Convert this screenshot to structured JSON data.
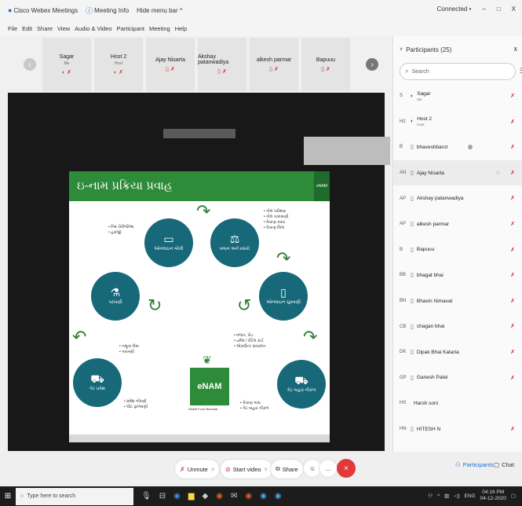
{
  "titlebar": {
    "app_name": "Cisco Webex Meetings",
    "meeting_info": "Meeting Info",
    "hide_menu": "Hide menu bar ^",
    "connected": "Connected •",
    "minimize": "–",
    "restore": "□",
    "close": "X"
  },
  "menubar": [
    "File",
    "Edit",
    "Share",
    "View",
    "Audio & Video",
    "Participant",
    "Meeting",
    "Help"
  ],
  "thumbnails": [
    {
      "name": "Sagar",
      "sub": "Me"
    },
    {
      "name": "Host 2",
      "sub": "Host"
    },
    {
      "name": "Ajay Nisarta",
      "sub": ""
    },
    {
      "name": "Akshay patanwadiya",
      "sub": ""
    },
    {
      "name": "alkesh parmar",
      "sub": ""
    },
    {
      "name": "Bapuuu",
      "sub": ""
    }
  ],
  "slide": {
    "title": "ઇ-નામ પ્રક્રિયા પ્રવાહ",
    "logo": "eNAM",
    "enam_text": "eNAM",
    "enam_tagline": "eNAM Food Bhandar",
    "stages": [
      {
        "label": "ઓનલાઇન બોલી"
      },
      {
        "label": "વજન અને વધારો"
      },
      {
        "label": "ઓનલાઇન ચુકવણી"
      },
      {
        "label": "ગેટ બહાર નીકળ"
      },
      {
        "label": "ગેટ પ્રવેશ"
      },
      {
        "label": "પરખણી"
      }
    ],
    "bullets": [
      "• નિદ ચેરીજોઆ\n• હરાજી",
      "• તોલ પરીક્ષણ\n• તોલ ચકાસણી\n• વેચાણ કરાર\n• વેચાણ બિલ",
      "• નમૂના લેવા\n• પરખણી",
      "• વજન, ખેડ\n• ઇમેલ / રીટેલ કાર્ડ\n• એકાઉન્ટ સંચાલન",
      "• પ્રવેશ નોંધણી\n• લોટ ફાળવણી",
      "• વેચાણ પાસ\n• ગેટ બહાર નીકળ"
    ]
  },
  "participants_panel": {
    "title": "Participants (25)",
    "close": "x",
    "search_placeholder": "Search",
    "list": [
      {
        "avatar": "S",
        "name": "Sagar",
        "sub": "Me"
      },
      {
        "avatar": "H2",
        "name": "Host 2",
        "sub": "Host"
      },
      {
        "avatar": "B",
        "name": "bhaveshbarot",
        "sub": ""
      },
      {
        "avatar": "AN",
        "name": "Ajay Nisarta",
        "sub": ""
      },
      {
        "avatar": "AP",
        "name": "Akshay patanwadiya",
        "sub": ""
      },
      {
        "avatar": "AP",
        "name": "alkesh parmar",
        "sub": ""
      },
      {
        "avatar": "B",
        "name": "Bapuuu",
        "sub": ""
      },
      {
        "avatar": "BB",
        "name": "bhagat bhai",
        "sub": ""
      },
      {
        "avatar": "BN",
        "name": "Bhavin Nimavat",
        "sub": ""
      },
      {
        "avatar": "CB",
        "name": "chagan bhai",
        "sub": ""
      },
      {
        "avatar": "DK",
        "name": "Dipak Bhai Kataria",
        "sub": ""
      },
      {
        "avatar": "GP",
        "name": "Ganesh Patel",
        "sub": ""
      },
      {
        "avatar": "HS",
        "name": "Harsh soni",
        "sub": ""
      },
      {
        "avatar": "HN",
        "name": "HITESH N",
        "sub": ""
      }
    ]
  },
  "controls": {
    "unmute": "Unmute",
    "start_video": "Start video",
    "share": "Share",
    "more": "...",
    "end": "×",
    "participants": "Participants",
    "chat": "Chat"
  },
  "taskbar": {
    "search_placeholder": "Type here to search",
    "lang": "ENG",
    "time": "04:16 PM",
    "date": "04-12-2020"
  },
  "colors": {
    "slide_green": "#2e8b3a",
    "circle_teal": "#17697a",
    "end_red": "#e23a3a",
    "mic_red": "#cc3333"
  }
}
